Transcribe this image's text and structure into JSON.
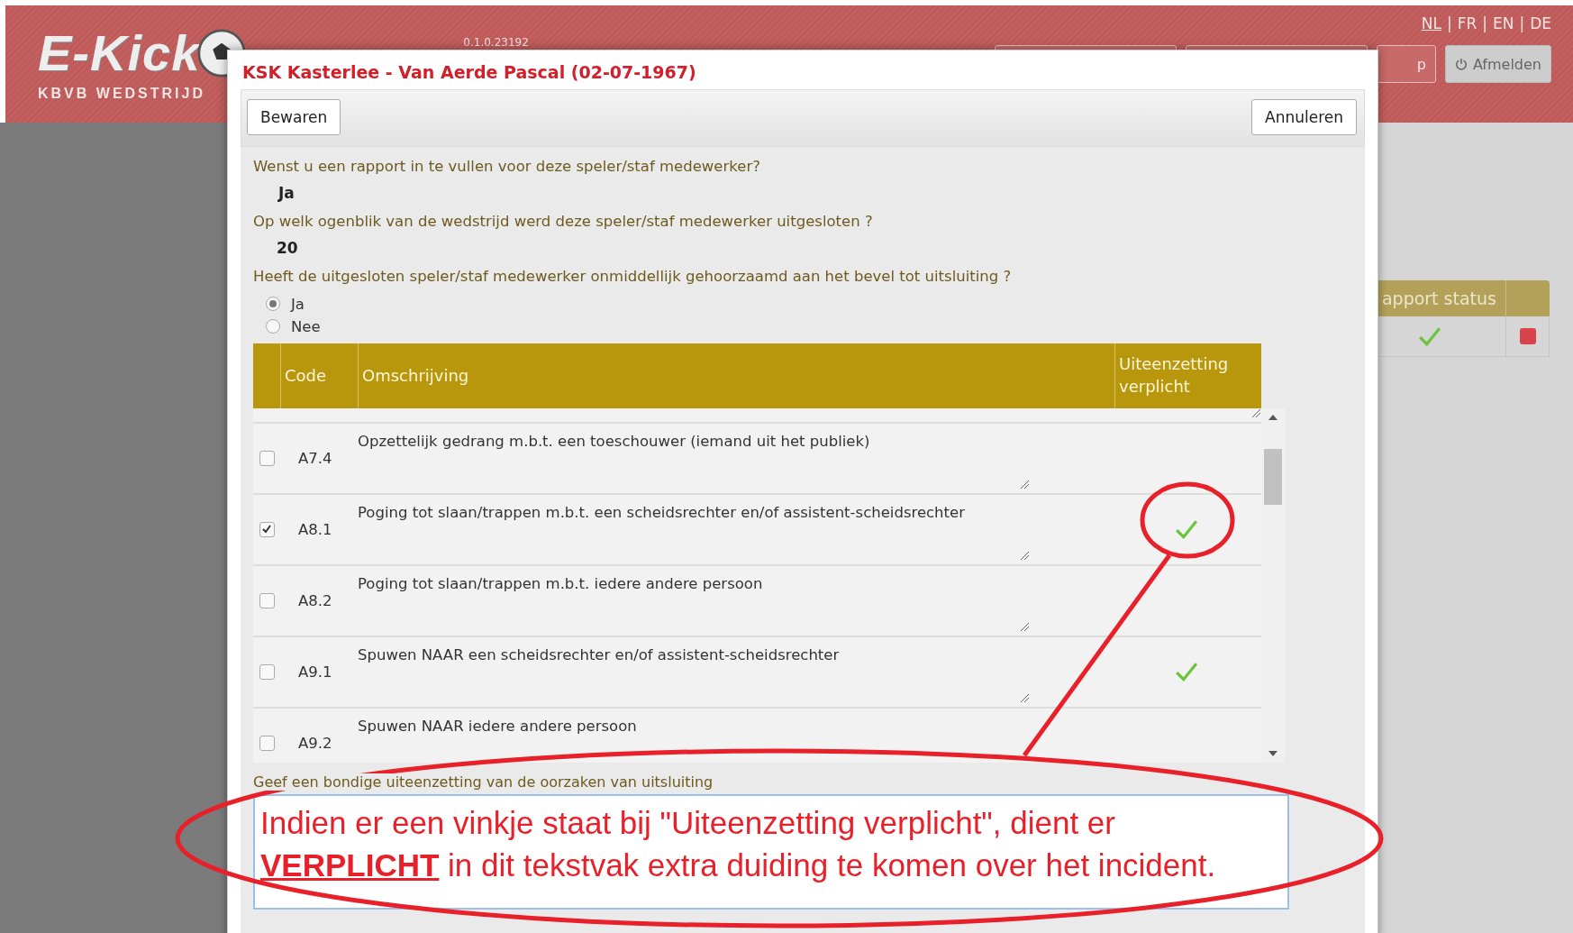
{
  "header": {
    "logo": "E-Kick",
    "subtitle": "KBVB WEDSTRIJD",
    "version": "0.1.0.23192",
    "languages": [
      {
        "label": "NL",
        "selected": true
      },
      {
        "label": "FR",
        "selected": false
      },
      {
        "label": "EN",
        "selected": false
      },
      {
        "label": "DE",
        "selected": false
      }
    ],
    "separator": "|",
    "buttons": [
      {
        "kind": "plain",
        "label": "p"
      },
      {
        "kind": "logout",
        "label": "Afmelden"
      }
    ]
  },
  "background_table": {
    "column": "apport status",
    "rows": [
      {
        "report_ok": true,
        "flagged": true
      }
    ]
  },
  "dialog": {
    "title": "KSK Kasterlee - Van Aerde Pascal (02-07-1967)",
    "buttons": [
      "Bewaren",
      "Annuleren"
    ],
    "questions": [
      {
        "kind": "answer",
        "question": "Wenst u een rapport in te vullen voor deze speler/staf medewerker?",
        "answer": "Ja"
      },
      {
        "kind": "answer",
        "question": "Op welk ogenblik van de wedstrijd werd deze speler/staf medewerker uitgesloten ?",
        "answer": "20"
      },
      {
        "kind": "radio",
        "question": "Heeft de uitgesloten speler/staf medewerker onmiddellijk gehoorzaamd aan het bevel tot uitsluiting ?",
        "options": [
          {
            "label": "Ja",
            "selected": true
          },
          {
            "label": "Nee",
            "selected": false
          }
        ]
      }
    ],
    "table": {
      "columns": [
        "Code",
        "Omschrijving",
        "Uiteenzetting verplicht"
      ],
      "rows": [
        {
          "checked": false,
          "code": "A7.4",
          "description": "Opzettelijk gedrang m.b.t. een toeschouwer (iemand uit het publiek)",
          "required": false
        },
        {
          "checked": true,
          "code": "A8.1",
          "description": "Poging tot slaan/trappen m.b.t. een scheidsrechter en/of assistent-scheidsrechter",
          "required": true
        },
        {
          "checked": false,
          "code": "A8.2",
          "description": "Poging tot slaan/trappen m.b.t. iedere andere persoon",
          "required": false
        },
        {
          "checked": false,
          "code": "A9.1",
          "description": "Spuwen NAAR een scheidsrechter en/of assistent-scheidsrechter",
          "required": true
        },
        {
          "checked": false,
          "code": "A9.2",
          "description": "Spuwen NAAR iedere andere persoon",
          "required": false
        }
      ]
    },
    "explanation_label": "Geef een bondige uiteenzetting van de oorzaken van uitsluiting",
    "annotation": [
      "Indien er een vinkje staat bij \"Uiteenzetting verplicht\", dient er",
      "**VERPLICHT** in dit tekstvak extra duiding te komen over het incident."
    ]
  }
}
